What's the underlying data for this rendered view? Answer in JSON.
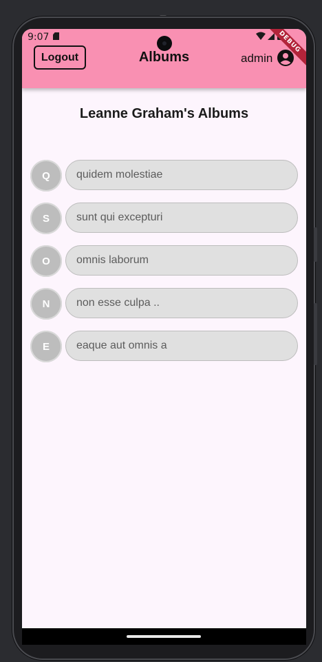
{
  "status_bar": {
    "time": "9:07",
    "icons": [
      "sd-card-icon",
      "wifi-icon",
      "signal-icon",
      "battery-icon"
    ]
  },
  "appbar": {
    "logout_label": "Logout",
    "title": "Albums",
    "user_name": "admin",
    "account_icon": "account-circle-icon",
    "background": "#f990b2"
  },
  "debug_banner": "DEBUG",
  "page": {
    "heading": "Leanne Graham's Albums",
    "background": "#fdf5fd"
  },
  "albums": [
    {
      "initial": "Q",
      "title": "quidem molestiae"
    },
    {
      "initial": "S",
      "title": "sunt qui excepturi"
    },
    {
      "initial": "O",
      "title": "omnis laborum"
    },
    {
      "initial": "N",
      "title": "non esse culpa .."
    },
    {
      "initial": "E",
      "title": "eaque aut omnis a"
    }
  ],
  "colors": {
    "avatar": "#bdbdbd",
    "pill": "#e0e0e0",
    "pill_text": "#5c5c5c"
  }
}
